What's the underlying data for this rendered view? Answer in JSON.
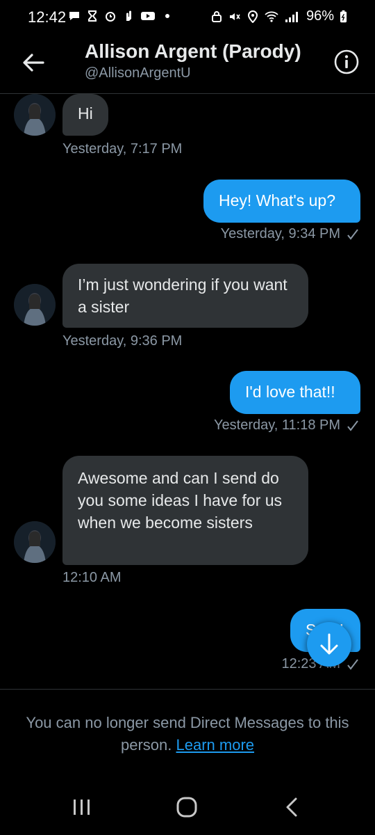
{
  "status_bar": {
    "time": "12:42",
    "battery": "96%"
  },
  "header": {
    "title": "Allison Argent (Parody)",
    "handle": "@AllisonArgentU"
  },
  "messages": [
    {
      "direction": "in",
      "text": "Hi",
      "timestamp": "Yesterday, 7:17 PM"
    },
    {
      "direction": "out",
      "text": "Hey! What's up?",
      "timestamp": "Yesterday, 9:34 PM",
      "seen": true
    },
    {
      "direction": "in",
      "text": "I’m just wondering if you want a sister",
      "timestamp": "Yesterday, 9:36 PM"
    },
    {
      "direction": "out",
      "text": "I'd love that!!",
      "timestamp": "Yesterday, 11:18 PM",
      "seen": true
    },
    {
      "direction": "in",
      "text": "Awesome and can I send do you some ideas I have for us when we become sisters",
      "timestamp": "12:10 AM"
    },
    {
      "direction": "out",
      "text": "Sure!",
      "timestamp": "12:23 AM",
      "seen": true
    }
  ],
  "footer": {
    "notice": "You can no longer send Direct Messages to this person.",
    "link": "Learn more"
  },
  "colors": {
    "accent": "#1d9bf0",
    "incoming_bubble": "#2f3336",
    "muted_text": "#8b98a5",
    "background": "#000000"
  },
  "icons": {
    "back": "arrow-left-icon",
    "info": "info-icon",
    "scroll_down": "arrow-down-icon"
  }
}
